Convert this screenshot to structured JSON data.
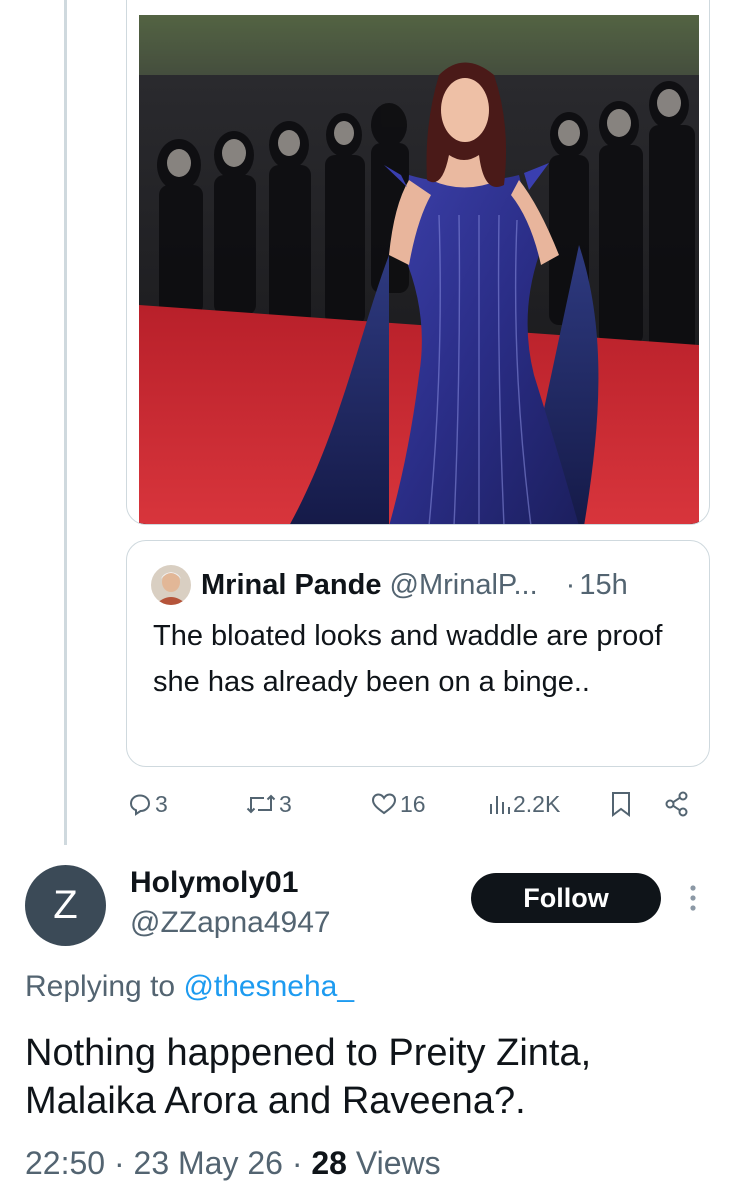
{
  "media": {
    "icon": "photo-red-carpet"
  },
  "quoted_tweet": {
    "avatar_icon": "profile-avatar",
    "display_name": "Mrinal Pande",
    "handle": "@MrinalP...",
    "separator": "·",
    "time": "15h",
    "text": "The bloated looks and waddle are proof she has already been on a binge.."
  },
  "actions": {
    "replies": "3",
    "reposts": "3",
    "likes": "16",
    "views": "2.2K",
    "icons": [
      "reply-icon",
      "repost-icon",
      "like-icon",
      "views-icon",
      "bookmark-icon",
      "share-icon"
    ]
  },
  "reply_tweet": {
    "avatar_letter": "Z",
    "avatar_color": "#3b4a57",
    "display_name": "Holymoly01",
    "username": "@ZZapna4947",
    "follow_label": "Follow",
    "replying_prefix": "Replying to",
    "replying_to": "@thesneha_",
    "text": "Nothing happened to Preity Zinta, Malaika Arora and Raveena?.",
    "time": "22:50",
    "sep1": "·",
    "date": "23 May 26",
    "sep2": "·",
    "views_count": "28",
    "views_label": "Views"
  },
  "colors": {
    "text_primary": "#0f1419",
    "text_secondary": "#536471",
    "accent": "#1d9bf0",
    "border": "#cfd9de"
  }
}
